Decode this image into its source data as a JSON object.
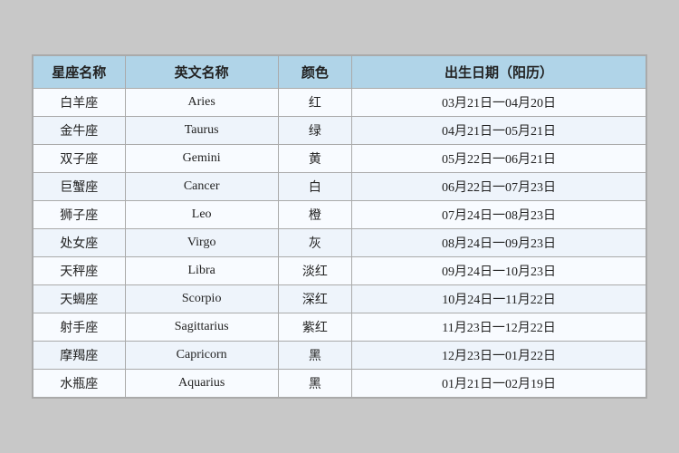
{
  "table": {
    "headers": [
      "星座名称",
      "英文名称",
      "颜色",
      "出生日期（阳历）"
    ],
    "rows": [
      {
        "cn": "白羊座",
        "en": "Aries",
        "color": "红",
        "date": "03月21日一04月20日"
      },
      {
        "cn": "金牛座",
        "en": "Taurus",
        "color": "绿",
        "date": "04月21日一05月21日"
      },
      {
        "cn": "双子座",
        "en": "Gemini",
        "color": "黄",
        "date": "05月22日一06月21日"
      },
      {
        "cn": "巨蟹座",
        "en": "Cancer",
        "color": "白",
        "date": "06月22日一07月23日"
      },
      {
        "cn": "狮子座",
        "en": "Leo",
        "color": "橙",
        "date": "07月24日一08月23日"
      },
      {
        "cn": "处女座",
        "en": "Virgo",
        "color": "灰",
        "date": "08月24日一09月23日"
      },
      {
        "cn": "天秤座",
        "en": "Libra",
        "color": "淡红",
        "date": "09月24日一10月23日"
      },
      {
        "cn": "天蝎座",
        "en": "Scorpio",
        "color": "深红",
        "date": "10月24日一11月22日"
      },
      {
        "cn": "射手座",
        "en": "Sagittarius",
        "color": "紫红",
        "date": "11月23日一12月22日"
      },
      {
        "cn": "摩羯座",
        "en": "Capricorn",
        "color": "黑",
        "date": "12月23日一01月22日"
      },
      {
        "cn": "水瓶座",
        "en": "Aquarius",
        "color": "黑",
        "date": "01月21日一02月19日"
      }
    ]
  }
}
